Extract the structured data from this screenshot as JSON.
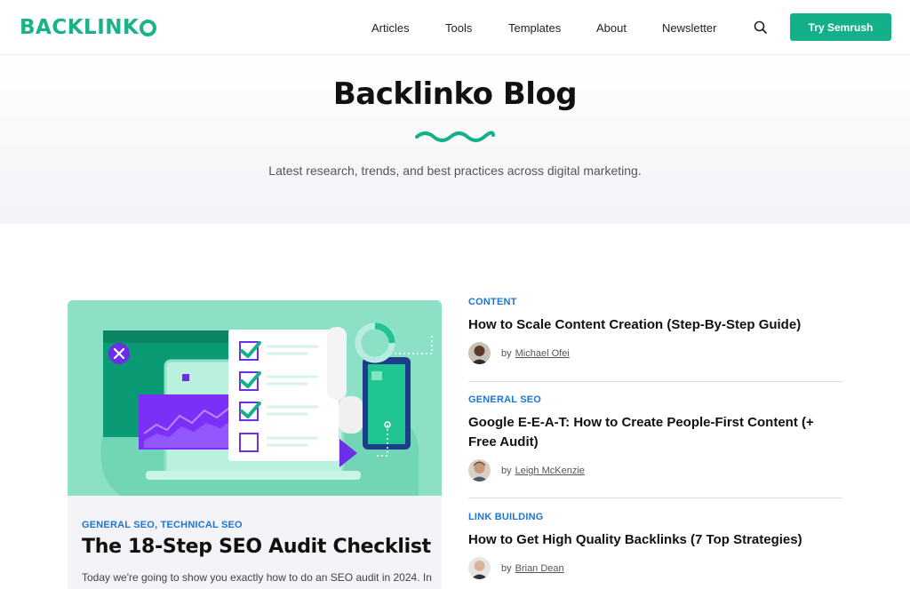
{
  "header": {
    "logo_text": "BACKLINK",
    "nav": [
      {
        "label": "Articles"
      },
      {
        "label": "Tools"
      },
      {
        "label": "Templates"
      },
      {
        "label": "About"
      },
      {
        "label": "Newsletter"
      }
    ],
    "search_icon": "search-icon",
    "cta_label": "Try Semrush"
  },
  "hero": {
    "title": "Backlinko Blog",
    "subtitle": "Latest research, trends, and best practices across digital marketing."
  },
  "featured": {
    "tags": "GENERAL SEO, TECHNICAL SEO",
    "title": "The 18-Step SEO Audit Checklist",
    "excerpt": "Today we're going to show you exactly how to do an SEO audit in 2024. In"
  },
  "articles": [
    {
      "tag": "CONTENT",
      "title": "How to Scale Content Creation (Step-By-Step Guide)",
      "by": "by",
      "author": "Michael Ofei"
    },
    {
      "tag": "GENERAL SEO",
      "title": "Google E-E-A-T: How to Create People-First Content (+ Free Audit)",
      "by": "by",
      "author": "Leigh McKenzie"
    },
    {
      "tag": "LINK BUILDING",
      "title": "How to Get High Quality Backlinks (7 Top Strategies)",
      "by": "by",
      "author": "Brian Dean"
    }
  ],
  "colors": {
    "brand_green": "#14b08a",
    "tag_blue": "#1d76d2",
    "illustration_bg": "#8ce0c6",
    "illustration_purple": "#7b2ff7"
  }
}
